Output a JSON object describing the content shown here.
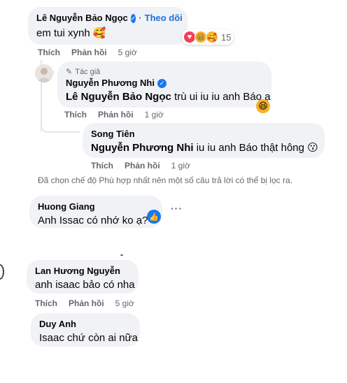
{
  "actions": {
    "like": "Thích",
    "reply": "Phản hồi"
  },
  "comments": [
    {
      "author": "Lê Nguyễn Bảo Ngọc",
      "follow": "Theo dõi",
      "text": "em tui xynh",
      "emoji": "🥰",
      "time": "5 giờ",
      "reaction_count": "15",
      "reaction_icons": [
        "heart",
        "laugh",
        "love"
      ]
    },
    {
      "author_badge": "Tác giả",
      "author": "Nguyễn Phương Nhi",
      "mention": "Lê Nguyễn Bảo Ngọc",
      "text": "trù ui iu iu anh Báo ạ",
      "emoji_reaction": "😆",
      "time": "1 giờ"
    },
    {
      "author": "Song Tiên",
      "mention": "Nguyễn Phương Nhi",
      "text": "iu iu anh Báo thật hông",
      "emoji": "😗",
      "time": "1 giờ"
    },
    {
      "author": "Huong Giang",
      "text": "Anh Issac có nhớ ko ạ?"
    },
    {
      "author": "Lan Hương Nguyễn",
      "text": "anh isaac bảo có nha",
      "time": "5 giờ"
    },
    {
      "author": "Duy Anh",
      "text": "Isaac chứ còn ai nữa"
    }
  ],
  "filter_note": "Đã chọn chế độ Phù hợp nhất nên một số câu trả lời có thể bị lọc ra.",
  "colors": {
    "bubble": "#f0f2f5",
    "link": "#216fdb",
    "verified": "#1877f2",
    "muted": "#65676b"
  }
}
